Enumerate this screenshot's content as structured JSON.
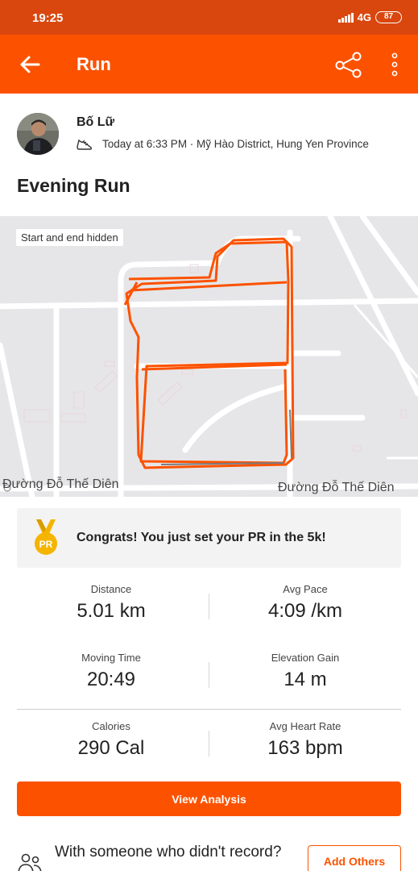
{
  "status_bar": {
    "time": "19:25",
    "network": "4G",
    "battery": "87"
  },
  "app_bar": {
    "title": "Run"
  },
  "header": {
    "athlete_name": "Bố Lữ",
    "meta": "Today at 6:33 PM · Mỹ Hào District, Hung Yen Province"
  },
  "activity": {
    "title": "Evening Run"
  },
  "map": {
    "note": "Start and end hidden",
    "street_left": "Đường Đỗ Thế Diên",
    "street_right": "Đường Đỗ Thế Diên",
    "route_color": "#fc5200"
  },
  "pr_banner": {
    "text": "Congrats! You just set your PR in the 5k!",
    "medal_label": "PR"
  },
  "stats": {
    "distance": {
      "label": "Distance",
      "value": "5.01 km"
    },
    "avg_pace": {
      "label": "Avg Pace",
      "value": "4:09 /km"
    },
    "moving_time": {
      "label": "Moving Time",
      "value": "20:49"
    },
    "elevation_gain": {
      "label": "Elevation Gain",
      "value": "14 m"
    },
    "calories": {
      "label": "Calories",
      "value": "290 Cal"
    },
    "avg_heart_rate": {
      "label": "Avg Heart Rate",
      "value": "163 bpm"
    }
  },
  "actions": {
    "view_analysis": "View Analysis",
    "with_someone": "With someone who didn't record?",
    "add_others": "Add Others"
  },
  "colors": {
    "brand": "#fc5200",
    "status_bar": "#d9470f"
  },
  "icons": [
    "back-arrow-icon",
    "share-icon",
    "more-vertical-icon",
    "shoe-icon",
    "medal-icon",
    "people-icon"
  ]
}
